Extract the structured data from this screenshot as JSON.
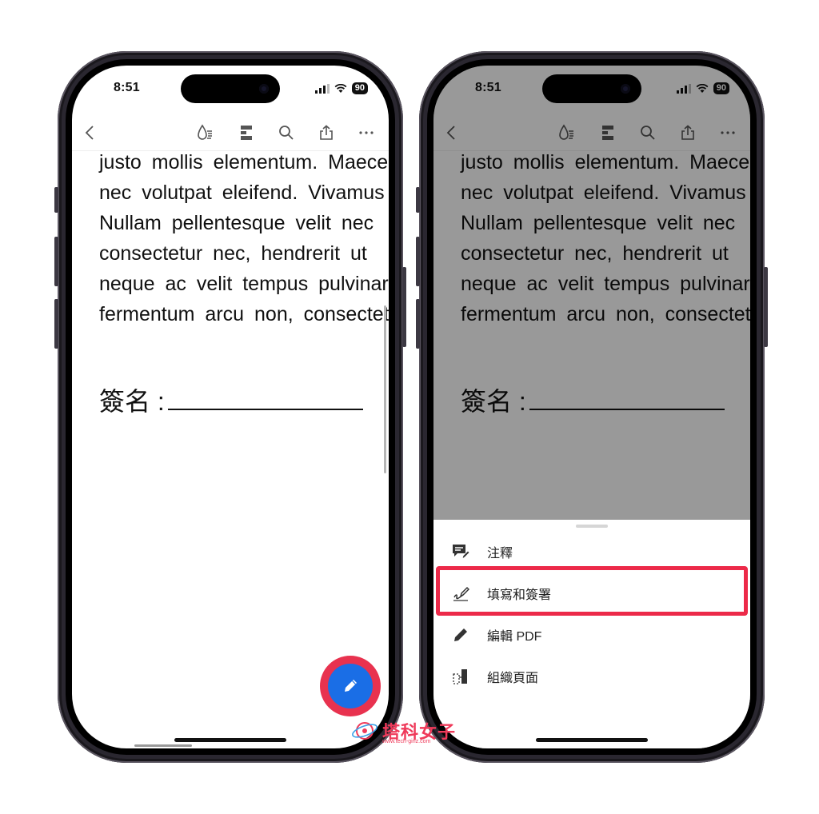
{
  "status": {
    "time": "8:51",
    "battery": "90"
  },
  "document": {
    "lines": [
      "justo mollis elementum. Maecenas",
      "nec volutpat eleifend. Vivamus",
      "Nullam pellentesque velit nec",
      "consectetur nec, hendrerit ut",
      "neque ac velit tempus pulvinar",
      "fermentum arcu non, consectetur"
    ],
    "signature_label": "簽名 :"
  },
  "menu": {
    "items": [
      {
        "label": "注釋",
        "icon": "comment-pen-icon"
      },
      {
        "label": "填寫和簽署",
        "icon": "signature-pen-icon"
      },
      {
        "label": "編輯 PDF",
        "icon": "pencil-icon"
      },
      {
        "label": "組織頁面",
        "icon": "organize-pages-icon"
      }
    ]
  },
  "watermark": {
    "text": "塔科女子",
    "url": "www.tech-girlz.com"
  },
  "colors": {
    "fab": "#1a6ee6",
    "highlight": "#ec2a49",
    "overlay": "rgba(0,0,0,0.4)"
  }
}
